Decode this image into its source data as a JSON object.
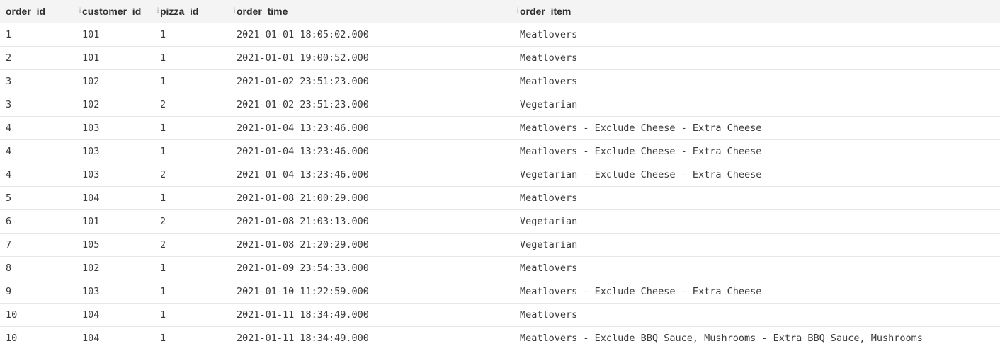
{
  "table": {
    "columns": [
      "order_id",
      "customer_id",
      "pizza_id",
      "order_time",
      "order_item"
    ],
    "rows": [
      [
        "1",
        "101",
        "1",
        "2021-01-01 18:05:02.000",
        "Meatlovers"
      ],
      [
        "2",
        "101",
        "1",
        "2021-01-01 19:00:52.000",
        "Meatlovers"
      ],
      [
        "3",
        "102",
        "1",
        "2021-01-02 23:51:23.000",
        "Meatlovers"
      ],
      [
        "3",
        "102",
        "2",
        "2021-01-02 23:51:23.000",
        "Vegetarian"
      ],
      [
        "4",
        "103",
        "1",
        "2021-01-04 13:23:46.000",
        "Meatlovers - Exclude Cheese - Extra Cheese"
      ],
      [
        "4",
        "103",
        "1",
        "2021-01-04 13:23:46.000",
        "Meatlovers - Exclude Cheese - Extra Cheese"
      ],
      [
        "4",
        "103",
        "2",
        "2021-01-04 13:23:46.000",
        "Vegetarian - Exclude Cheese - Extra Cheese"
      ],
      [
        "5",
        "104",
        "1",
        "2021-01-08 21:00:29.000",
        "Meatlovers"
      ],
      [
        "6",
        "101",
        "2",
        "2021-01-08 21:03:13.000",
        "Vegetarian"
      ],
      [
        "7",
        "105",
        "2",
        "2021-01-08 21:20:29.000",
        "Vegetarian"
      ],
      [
        "8",
        "102",
        "1",
        "2021-01-09 23:54:33.000",
        "Meatlovers"
      ],
      [
        "9",
        "103",
        "1",
        "2021-01-10 11:22:59.000",
        "Meatlovers - Exclude Cheese - Extra Cheese"
      ],
      [
        "10",
        "104",
        "1",
        "2021-01-11 18:34:49.000",
        "Meatlovers"
      ],
      [
        "10",
        "104",
        "1",
        "2021-01-11 18:34:49.000",
        "Meatlovers - Exclude BBQ Sauce, Mushrooms - Extra BBQ Sauce, Mushrooms"
      ]
    ]
  },
  "icons": {
    "column_separator": "column-resize-handle-icon"
  }
}
